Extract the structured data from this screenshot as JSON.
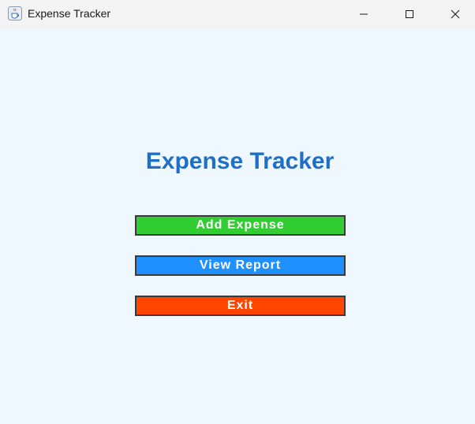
{
  "window": {
    "title": "Expense Tracker",
    "icon": "java-cup-icon"
  },
  "main": {
    "heading": "Expense Tracker",
    "buttons": {
      "add_label": "Add Expense",
      "view_label": "View Report",
      "exit_label": "Exit"
    }
  },
  "colors": {
    "background": "#f0f8ff",
    "heading": "#1f6fc8",
    "add_button": "#32cd32",
    "view_button": "#1e90ff",
    "exit_button": "#ff4500",
    "button_border": "#3a3a3a"
  }
}
